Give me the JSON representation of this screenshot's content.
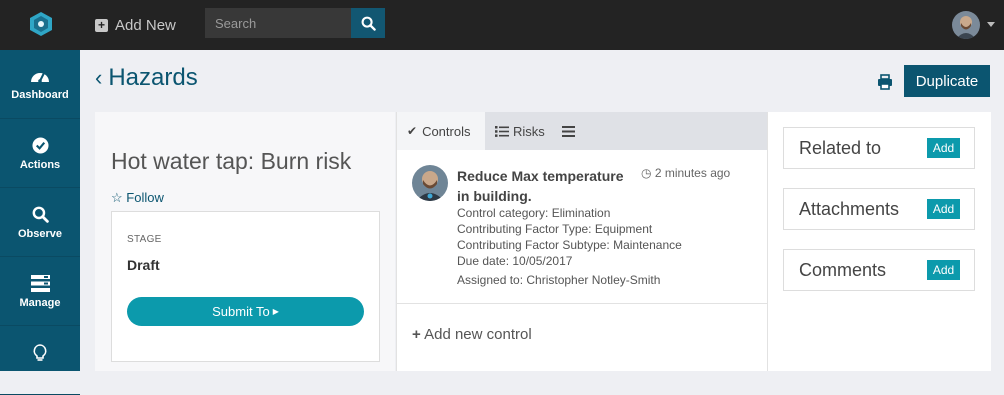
{
  "topbar": {
    "add_new_label": "Add New",
    "search_placeholder": "Search"
  },
  "sidebar": {
    "items": [
      {
        "label": "Dashboard",
        "icon": "dashboard-icon"
      },
      {
        "label": "Actions",
        "icon": "check-circle-icon"
      },
      {
        "label": "Observe",
        "icon": "search-icon"
      },
      {
        "label": "Manage",
        "icon": "manage-icon"
      },
      {
        "label": "",
        "icon": "lightbulb-icon"
      }
    ]
  },
  "page": {
    "back_title": "Hazards",
    "duplicate_label": "Duplicate"
  },
  "hazard": {
    "title": "Hot water tap: Burn risk",
    "follow_label": "Follow",
    "stage_label": "STAGE",
    "stage_value": "Draft",
    "submit_label": "Submit To"
  },
  "tabs": [
    {
      "label": "Controls",
      "active": true
    },
    {
      "label": "Risks",
      "active": false
    }
  ],
  "control": {
    "title": "Reduce Max temperature in building.",
    "time": "2 minutes ago",
    "category": "Control category: Elimination",
    "factor_type": "Contributing Factor Type: Equipment",
    "factor_subtype": "Contributing Factor Subtype: Maintenance",
    "due_date": "Due date: 10/05/2017",
    "assigned_to": "Assigned to: Christopher Notley-Smith"
  },
  "add_control_label": "Add new control",
  "related": [
    {
      "title": "Related to",
      "button": "Add"
    },
    {
      "title": "Attachments",
      "button": "Add"
    },
    {
      "title": "Comments",
      "button": "Add"
    }
  ],
  "colors": {
    "topbar": "#232323",
    "sidebar": "#0b5570",
    "primary": "#0b5570",
    "accent": "#0c9aac"
  }
}
